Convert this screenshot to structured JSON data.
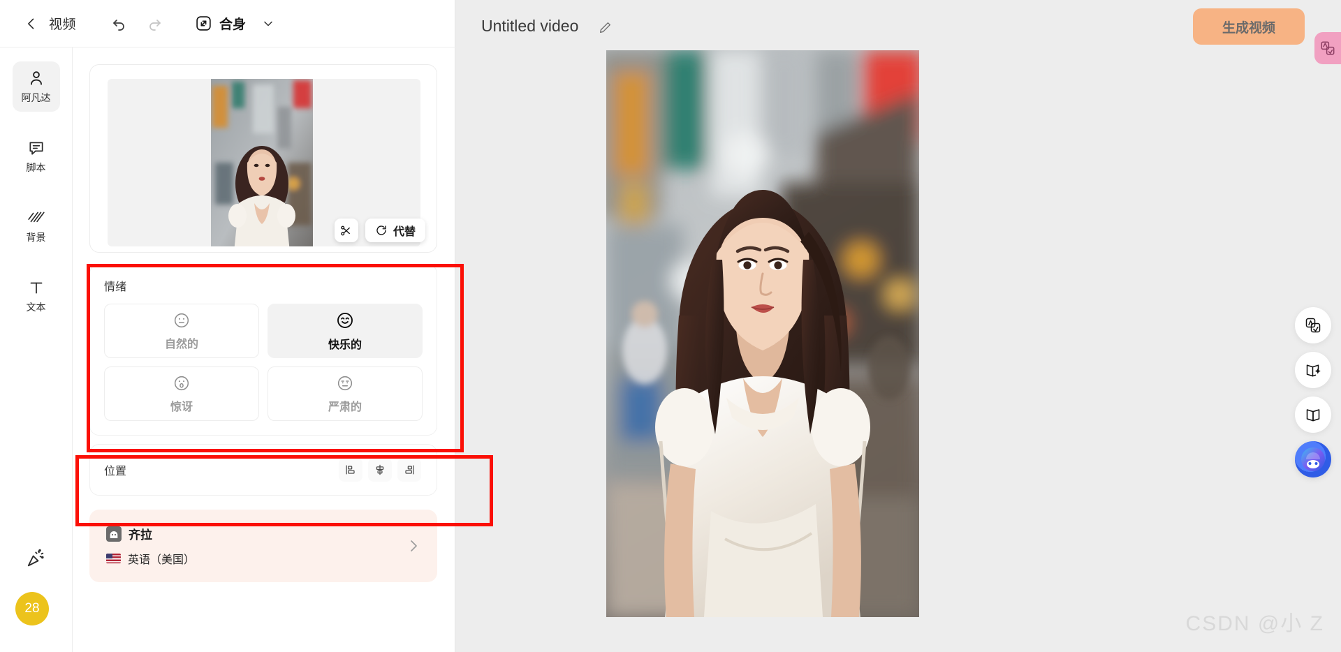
{
  "toolbar": {
    "back_icon": "chevron-left-icon",
    "title": "视频",
    "undo_icon": "undo-icon",
    "redo_icon": "redo-icon",
    "fit_icon": "fit-to-screen-icon",
    "fit_label": "合身",
    "fit_chevron_icon": "chevron-down-icon"
  },
  "sidebar": {
    "items": [
      {
        "label": "阿凡达",
        "icon": "person-icon",
        "active": true
      },
      {
        "label": "脚本",
        "icon": "speech-bubble-icon",
        "active": false
      },
      {
        "label": "背景",
        "icon": "diagonal-stripes-icon",
        "active": false
      },
      {
        "label": "文本",
        "icon": "text-t-icon",
        "active": false
      }
    ],
    "bottom_icon": "party-popper-icon",
    "credits": "28"
  },
  "preview": {
    "cut_icon": "scissors-icon",
    "replace_icon": "refresh-icon",
    "replace_label": "代替"
  },
  "emotion": {
    "title": "情绪",
    "options": [
      {
        "label": "自然的",
        "icon": "neutral-face-icon",
        "selected": false
      },
      {
        "label": "快乐的",
        "icon": "smiling-face-icon",
        "selected": true
      },
      {
        "label": "惊讶",
        "icon": "surprised-face-icon",
        "selected": false
      },
      {
        "label": "严肃的",
        "icon": "serious-face-icon",
        "selected": false
      }
    ]
  },
  "position": {
    "title": "位置",
    "buttons": [
      {
        "name": "align-left-icon"
      },
      {
        "name": "align-center-icon"
      },
      {
        "name": "align-right-icon"
      }
    ]
  },
  "voice": {
    "avatar_icon": "voice-avatar-icon",
    "name": "齐拉",
    "flag_icon": "us-flag-icon",
    "language": "英语（美国）",
    "chevron_icon": "chevron-right-icon"
  },
  "main": {
    "document_title": "Untitled video",
    "edit_icon": "pencil-icon",
    "generate_label": "生成视频",
    "translate_icon": "translate-badge-icon",
    "right_rail": [
      {
        "name": "translate-icon"
      },
      {
        "name": "book-sparkle-icon"
      },
      {
        "name": "book-icon"
      },
      {
        "name": "assistant-avatar-icon"
      }
    ],
    "watermark": "CSDN @小 Z"
  },
  "colors": {
    "accent_orange": "#f7b384",
    "annotation_red": "#fb0f06",
    "credit_yellow": "#ecc31c",
    "voice_card_bg": "#fdf1ec",
    "translate_pink": "#f1a0c1"
  }
}
